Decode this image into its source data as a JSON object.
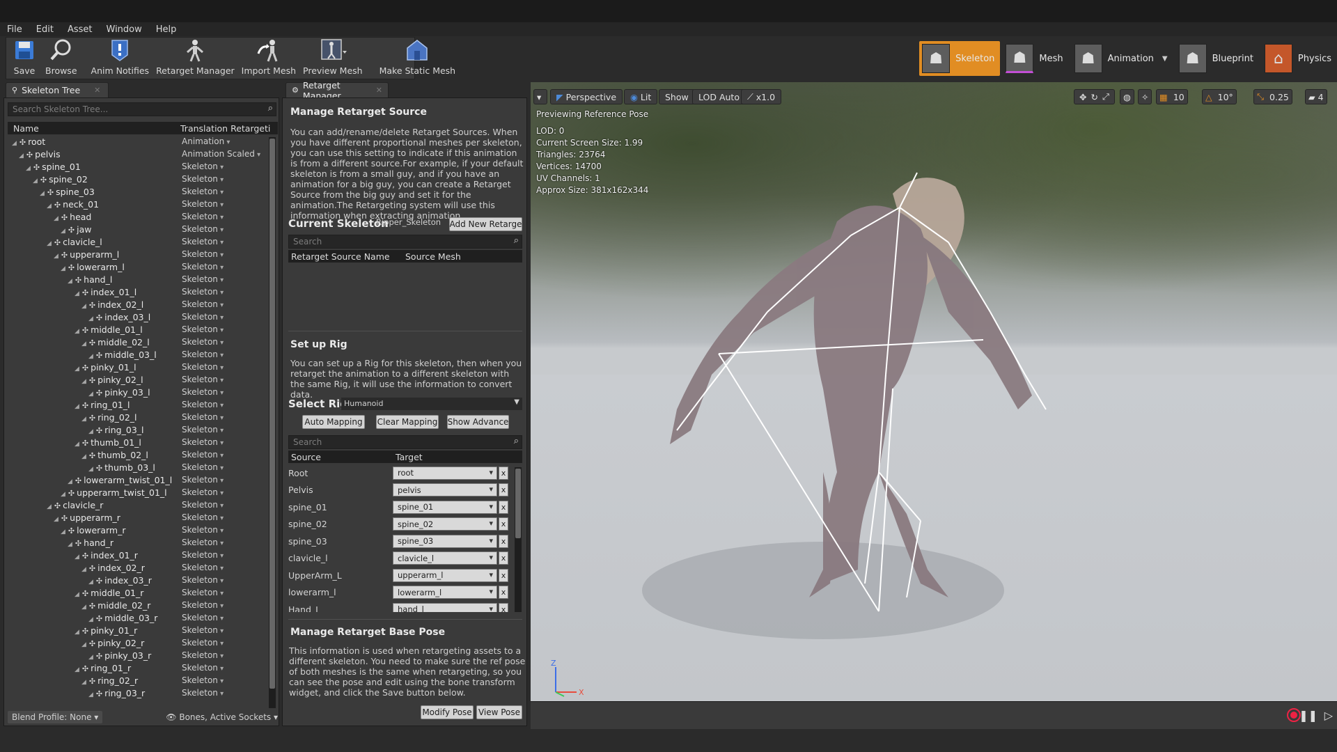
{
  "menu": [
    "File",
    "Edit",
    "Asset",
    "Window",
    "Help"
  ],
  "toolbar": [
    {
      "label": "Save",
      "icon": "save-icon"
    },
    {
      "label": "Browse",
      "icon": "browse-icon"
    },
    {
      "label": "Anim Notifies",
      "icon": "anim-notifies-icon"
    },
    {
      "label": "Retarget Manager",
      "icon": "retarget-manager-icon"
    },
    {
      "label": "Import Mesh",
      "icon": "import-mesh-icon"
    },
    {
      "label": "Preview Mesh",
      "icon": "preview-mesh-icon"
    },
    {
      "label": "Make Static Mesh",
      "icon": "make-static-mesh-icon"
    }
  ],
  "modes": [
    {
      "label": "Skeleton",
      "active": true
    },
    {
      "label": "Mesh",
      "active": false
    },
    {
      "label": "Animation",
      "active": false
    },
    {
      "label": "Blueprint",
      "active": false
    },
    {
      "label": "Physics",
      "active": false
    }
  ],
  "skeleton_tree": {
    "tab": "Skeleton Tree",
    "search_placeholder": "Search Skeleton Tree...",
    "col_name": "Name",
    "col_translation": "Translation Retargeti",
    "rows": [
      {
        "name": "root",
        "depth": 0,
        "mode": "Animation"
      },
      {
        "name": "pelvis",
        "depth": 1,
        "mode": "Animation Scaled"
      },
      {
        "name": "spine_01",
        "depth": 2,
        "mode": "Skeleton"
      },
      {
        "name": "spine_02",
        "depth": 3,
        "mode": "Skeleton"
      },
      {
        "name": "spine_03",
        "depth": 4,
        "mode": "Skeleton"
      },
      {
        "name": "neck_01",
        "depth": 5,
        "mode": "Skeleton"
      },
      {
        "name": "head",
        "depth": 6,
        "mode": "Skeleton"
      },
      {
        "name": "jaw",
        "depth": 7,
        "mode": "Skeleton"
      },
      {
        "name": "clavicle_l",
        "depth": 5,
        "mode": "Skeleton"
      },
      {
        "name": "upperarm_l",
        "depth": 6,
        "mode": "Skeleton"
      },
      {
        "name": "lowerarm_l",
        "depth": 7,
        "mode": "Skeleton"
      },
      {
        "name": "hand_l",
        "depth": 8,
        "mode": "Skeleton"
      },
      {
        "name": "index_01_l",
        "depth": 9,
        "mode": "Skeleton"
      },
      {
        "name": "index_02_l",
        "depth": 10,
        "mode": "Skeleton"
      },
      {
        "name": "index_03_l",
        "depth": 11,
        "mode": "Skeleton"
      },
      {
        "name": "middle_01_l",
        "depth": 9,
        "mode": "Skeleton"
      },
      {
        "name": "middle_02_l",
        "depth": 10,
        "mode": "Skeleton"
      },
      {
        "name": "middle_03_l",
        "depth": 11,
        "mode": "Skeleton"
      },
      {
        "name": "pinky_01_l",
        "depth": 9,
        "mode": "Skeleton"
      },
      {
        "name": "pinky_02_l",
        "depth": 10,
        "mode": "Skeleton"
      },
      {
        "name": "pinky_03_l",
        "depth": 11,
        "mode": "Skeleton"
      },
      {
        "name": "ring_01_l",
        "depth": 9,
        "mode": "Skeleton"
      },
      {
        "name": "ring_02_l",
        "depth": 10,
        "mode": "Skeleton"
      },
      {
        "name": "ring_03_l",
        "depth": 11,
        "mode": "Skeleton"
      },
      {
        "name": "thumb_01_l",
        "depth": 9,
        "mode": "Skeleton"
      },
      {
        "name": "thumb_02_l",
        "depth": 10,
        "mode": "Skeleton"
      },
      {
        "name": "thumb_03_l",
        "depth": 11,
        "mode": "Skeleton"
      },
      {
        "name": "lowerarm_twist_01_l",
        "depth": 8,
        "mode": "Skeleton"
      },
      {
        "name": "upperarm_twist_01_l",
        "depth": 7,
        "mode": "Skeleton"
      },
      {
        "name": "clavicle_r",
        "depth": 5,
        "mode": "Skeleton"
      },
      {
        "name": "upperarm_r",
        "depth": 6,
        "mode": "Skeleton"
      },
      {
        "name": "lowerarm_r",
        "depth": 7,
        "mode": "Skeleton"
      },
      {
        "name": "hand_r",
        "depth": 8,
        "mode": "Skeleton"
      },
      {
        "name": "index_01_r",
        "depth": 9,
        "mode": "Skeleton"
      },
      {
        "name": "index_02_r",
        "depth": 10,
        "mode": "Skeleton"
      },
      {
        "name": "index_03_r",
        "depth": 11,
        "mode": "Skeleton"
      },
      {
        "name": "middle_01_r",
        "depth": 9,
        "mode": "Skeleton"
      },
      {
        "name": "middle_02_r",
        "depth": 10,
        "mode": "Skeleton"
      },
      {
        "name": "middle_03_r",
        "depth": 11,
        "mode": "Skeleton"
      },
      {
        "name": "pinky_01_r",
        "depth": 9,
        "mode": "Skeleton"
      },
      {
        "name": "pinky_02_r",
        "depth": 10,
        "mode": "Skeleton"
      },
      {
        "name": "pinky_03_r",
        "depth": 11,
        "mode": "Skeleton"
      },
      {
        "name": "ring_01_r",
        "depth": 9,
        "mode": "Skeleton"
      },
      {
        "name": "ring_02_r",
        "depth": 10,
        "mode": "Skeleton"
      },
      {
        "name": "ring_03_r",
        "depth": 11,
        "mode": "Skeleton"
      }
    ],
    "footer_left": "Blend Profile: None",
    "footer_right": "Bones, Active Sockets"
  },
  "retarget": {
    "tab": "Retarget Manager",
    "source_title": "Manage Retarget Source",
    "source_text": "You can add/rename/delete Retarget Sources. When you have different proportional meshes per skeleton, you can use this setting to indicate if this animation is from a different source.For example, if your default skeleton is from a small guy, and if you have an animation for a big guy, you can create a Retarget Source from the big guy and set it for the animation.The Retargeting system will use this information when extracting animation.",
    "current_skeleton_label": "Current Skeleton",
    "current_skeleton_value": "Ripper_Skeleton",
    "add_button": "Add New Retarge",
    "search_placeholder": "Search",
    "col_source_name": "Retarget Source Name",
    "col_source_mesh": "Source Mesh",
    "rig_title": "Set up Rig",
    "rig_text": "You can set up a Rig for this skeleton, then when you retarget the animation to a different skeleton with the same Rig, it will use the information to convert data.",
    "select_rig_label": "Select Rig",
    "select_rig_value": "Humanoid",
    "auto_mapping": "Auto Mapping",
    "clear_mapping": "Clear Mapping",
    "show_advanced": "Show Advance",
    "col_source": "Source",
    "col_target": "Target",
    "mappings": [
      {
        "source": "Root",
        "target": "root"
      },
      {
        "source": "Pelvis",
        "target": "pelvis"
      },
      {
        "source": "spine_01",
        "target": "spine_01"
      },
      {
        "source": "spine_02",
        "target": "spine_02"
      },
      {
        "source": "spine_03",
        "target": "spine_03"
      },
      {
        "source": "clavicle_l",
        "target": "clavicle_l"
      },
      {
        "source": "UpperArm_L",
        "target": "upperarm_l"
      },
      {
        "source": "lowerarm_l",
        "target": "lowerarm_l"
      },
      {
        "source": "Hand_L",
        "target": "hand_l"
      }
    ],
    "clear_x": "x",
    "basepose_title": "Manage Retarget Base Pose",
    "basepose_text": "This information is used when retargeting assets to a different skeleton. You need to make sure the ref pose of both meshes is the same when retargeting, so you can see the pose and edit using the bone transform widget, and click the Save button below.",
    "modify_pose": "Modify Pose",
    "view_pose": "View Pose"
  },
  "viewport": {
    "perspective": "Perspective",
    "lit": "Lit",
    "show": "Show",
    "lod": "LOD Auto",
    "speed": "x1.0",
    "grid_snap": "10",
    "rot_snap": "10°",
    "scale_snap": "0.25",
    "cam_speed": "4",
    "preview_title": "Previewing Reference Pose",
    "stats": [
      "LOD: 0",
      "Current Screen Size: 1.99",
      "Triangles: 23764",
      "Vertices: 14700",
      "UV Channels: 1",
      "Approx Size: 381x162x344"
    ],
    "axis_z": "Z",
    "axis_x": "X"
  },
  "colors": {
    "accent": "#e18d23",
    "panel": "#3a3a3a",
    "record": "#e22244"
  }
}
